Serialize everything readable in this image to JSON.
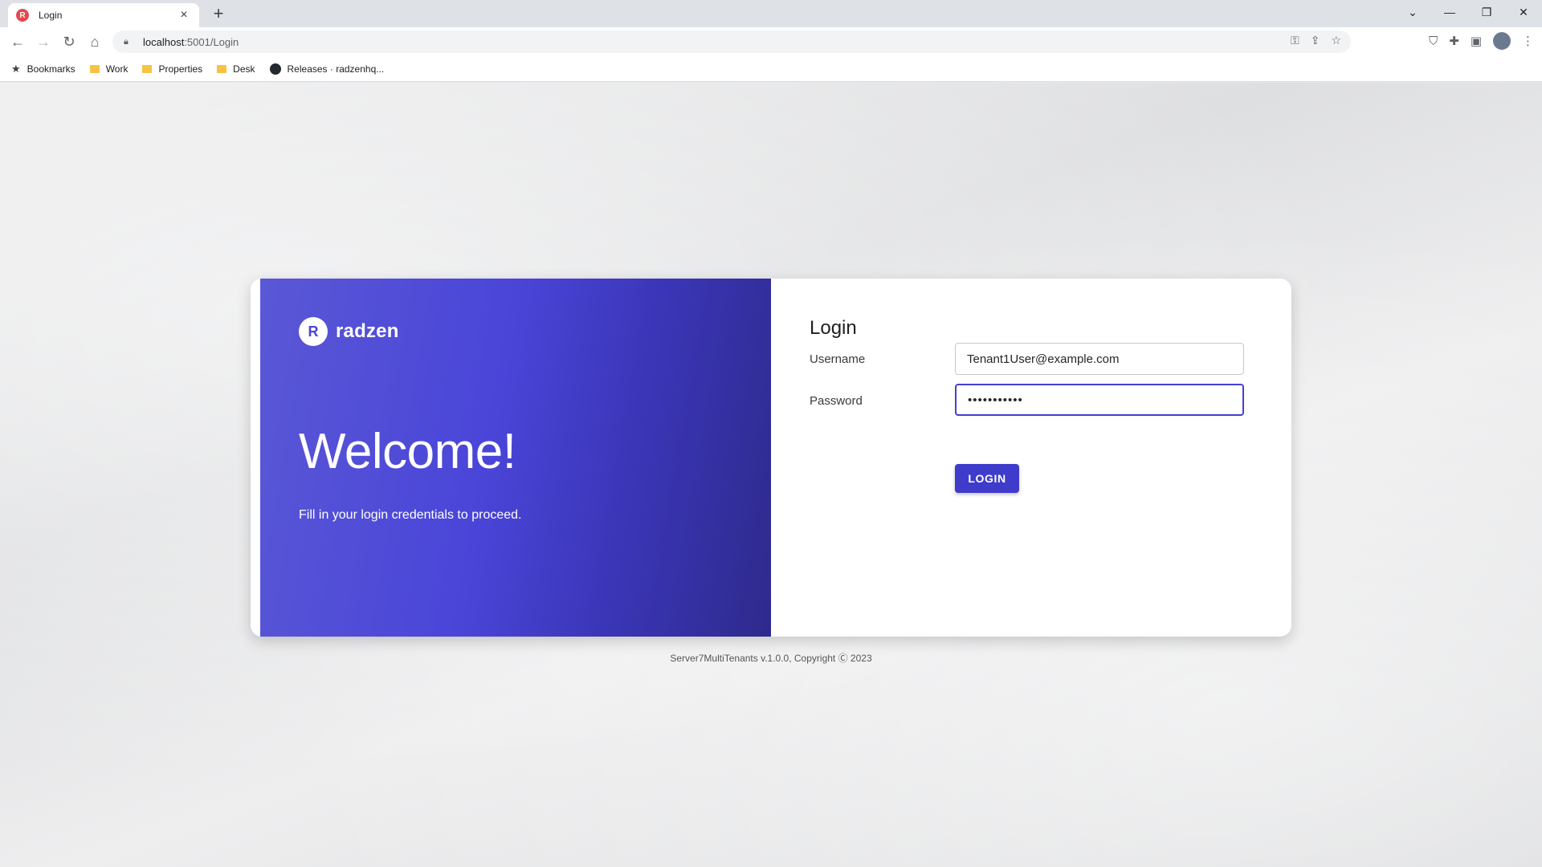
{
  "browser": {
    "tab_title": "Login",
    "tab_favicon": "radzen-favicon-icon",
    "url_host": "localhost",
    "url_path": ":5001/Login",
    "bookmarks": [
      {
        "label": "Bookmarks",
        "icon": "star-icon"
      },
      {
        "label": "Work",
        "icon": "folder-icon"
      },
      {
        "label": "Properties",
        "icon": "folder-icon"
      },
      {
        "label": "Desk",
        "icon": "folder-icon"
      },
      {
        "label": "Releases · radzenhq...",
        "icon": "github-icon"
      }
    ]
  },
  "brand": {
    "name": "radzen",
    "accent_color": "#4340d2"
  },
  "hero": {
    "title": "Welcome!",
    "subtitle": "Fill in your login credentials to proceed."
  },
  "form": {
    "title": "Login",
    "username_label": "Username",
    "username_value": "Tenant1User@example.com",
    "password_label": "Password",
    "password_value": "•••••••••••",
    "submit_label": "LOGIN"
  },
  "footer": {
    "text": "Server7MultiTenants v.1.0.0, Copyright Ⓒ 2023"
  }
}
